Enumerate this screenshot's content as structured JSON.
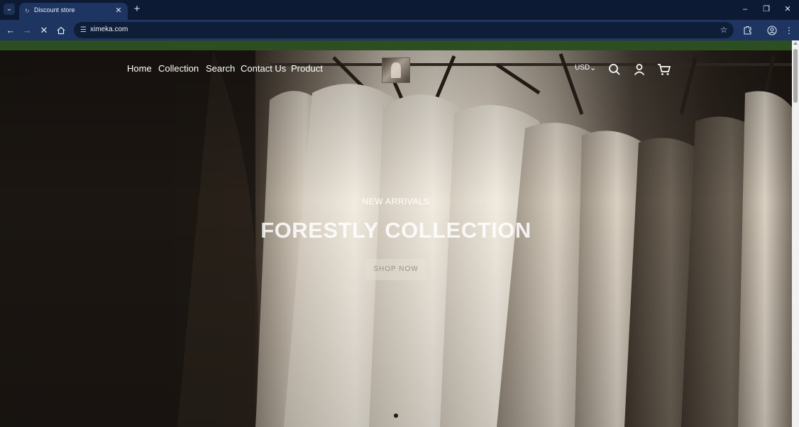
{
  "browser": {
    "tab": {
      "title": "Discount store"
    },
    "address": {
      "url": "ximeka.com"
    }
  },
  "site": {
    "nav": [
      "Home",
      "Collection",
      "Search",
      "Contact Us",
      "Product"
    ],
    "currency": "USD",
    "icons": [
      "search-icon",
      "account-icon",
      "cart-icon"
    ]
  },
  "hero": {
    "kicker": "NEW ARRIVALS",
    "title": "FORESTLY COLLECTION",
    "cta": "SHOP NOW"
  },
  "colors": {
    "browser_frame": "#0c1a33",
    "toolbar": "#1e3561",
    "announcement_bar": "#2d4d22",
    "hero_text": "#ffffff"
  }
}
